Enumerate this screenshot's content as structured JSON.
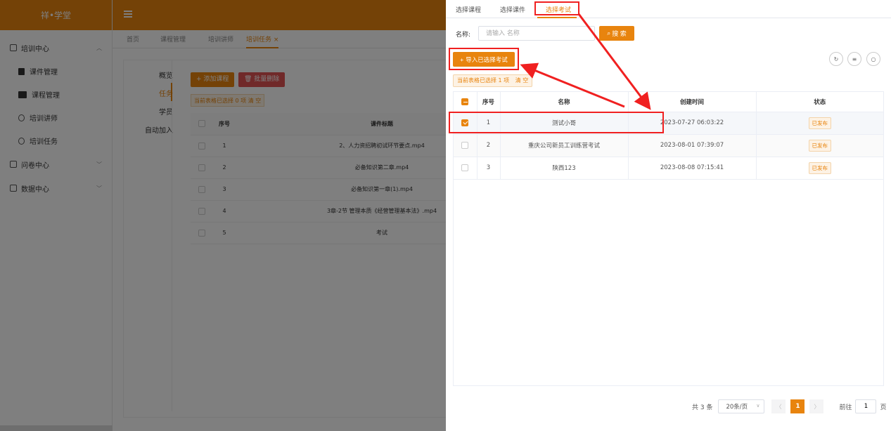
{
  "app": {
    "logo": "祥•学堂",
    "menu": [
      {
        "label": "培训中心",
        "icon": "document-icon"
      },
      {
        "label": "问卷中心",
        "icon": "survey-icon"
      },
      {
        "label": "数据中心",
        "icon": "chart-icon"
      }
    ],
    "submenu": [
      {
        "label": "课件管理",
        "icon": "file-icon"
      },
      {
        "label": "课程管理",
        "icon": "book-icon"
      },
      {
        "label": "培训讲师",
        "icon": "user-circle-icon"
      },
      {
        "label": "培训任务",
        "icon": "clock-icon"
      }
    ],
    "tags": [
      "首页",
      "课程管理",
      "培训讲师",
      "培训任务 ×"
    ],
    "subnav": [
      "概览",
      "任务",
      "学员",
      "自动加入"
    ],
    "add_course": "+ 添加课程",
    "batch_delete": "🗑 批量删除",
    "bg_selection": "当前表格已选择 0 项   清 空",
    "bg_table": {
      "headers": [
        "",
        "序号",
        "课件标题"
      ],
      "rows": [
        {
          "no": "1",
          "title": "2、人力资招聘初试环节要点.mp4"
        },
        {
          "no": "2",
          "title": "必备知识第二章.mp4"
        },
        {
          "no": "3",
          "title": "必备知识第一章(1).mp4"
        },
        {
          "no": "4",
          "title": "3章-2节 管理本质《经营管理基本法》.mp4"
        },
        {
          "no": "5",
          "title": "考试"
        }
      ]
    }
  },
  "drawer": {
    "tabs": [
      "选择课程",
      "选择课件",
      "选择考试"
    ],
    "active_tab": "选择考试",
    "search": {
      "label": "名称:",
      "placeholder": "请输入 名称",
      "button": "搜 索"
    },
    "import_button": "导入已选择考试",
    "selection": {
      "text": "当前表格已选择 1 项",
      "clear": "清 空"
    },
    "table": {
      "headers": [
        "",
        "序号",
        "名称",
        "创建时间",
        "状态"
      ],
      "rows": [
        {
          "checked": true,
          "no": "1",
          "name": "测试小哥",
          "created": "2023-07-27 06:03:22",
          "status": "已发布"
        },
        {
          "checked": false,
          "no": "2",
          "name": "重庆公司新员工训练营考试",
          "created": "2023-08-01 07:39:07",
          "status": "已发布"
        },
        {
          "checked": false,
          "no": "3",
          "name": "陕西123",
          "created": "2023-08-08 07:15:41",
          "status": "已发布"
        }
      ]
    },
    "pagination": {
      "total": "共 3 条",
      "page_size": "20条/页",
      "current_page": "1",
      "goto_label": "前往",
      "goto_value": "1",
      "goto_suffix": "页"
    }
  },
  "colors": {
    "accent": "#e8840e",
    "annotation": "#f02020"
  }
}
